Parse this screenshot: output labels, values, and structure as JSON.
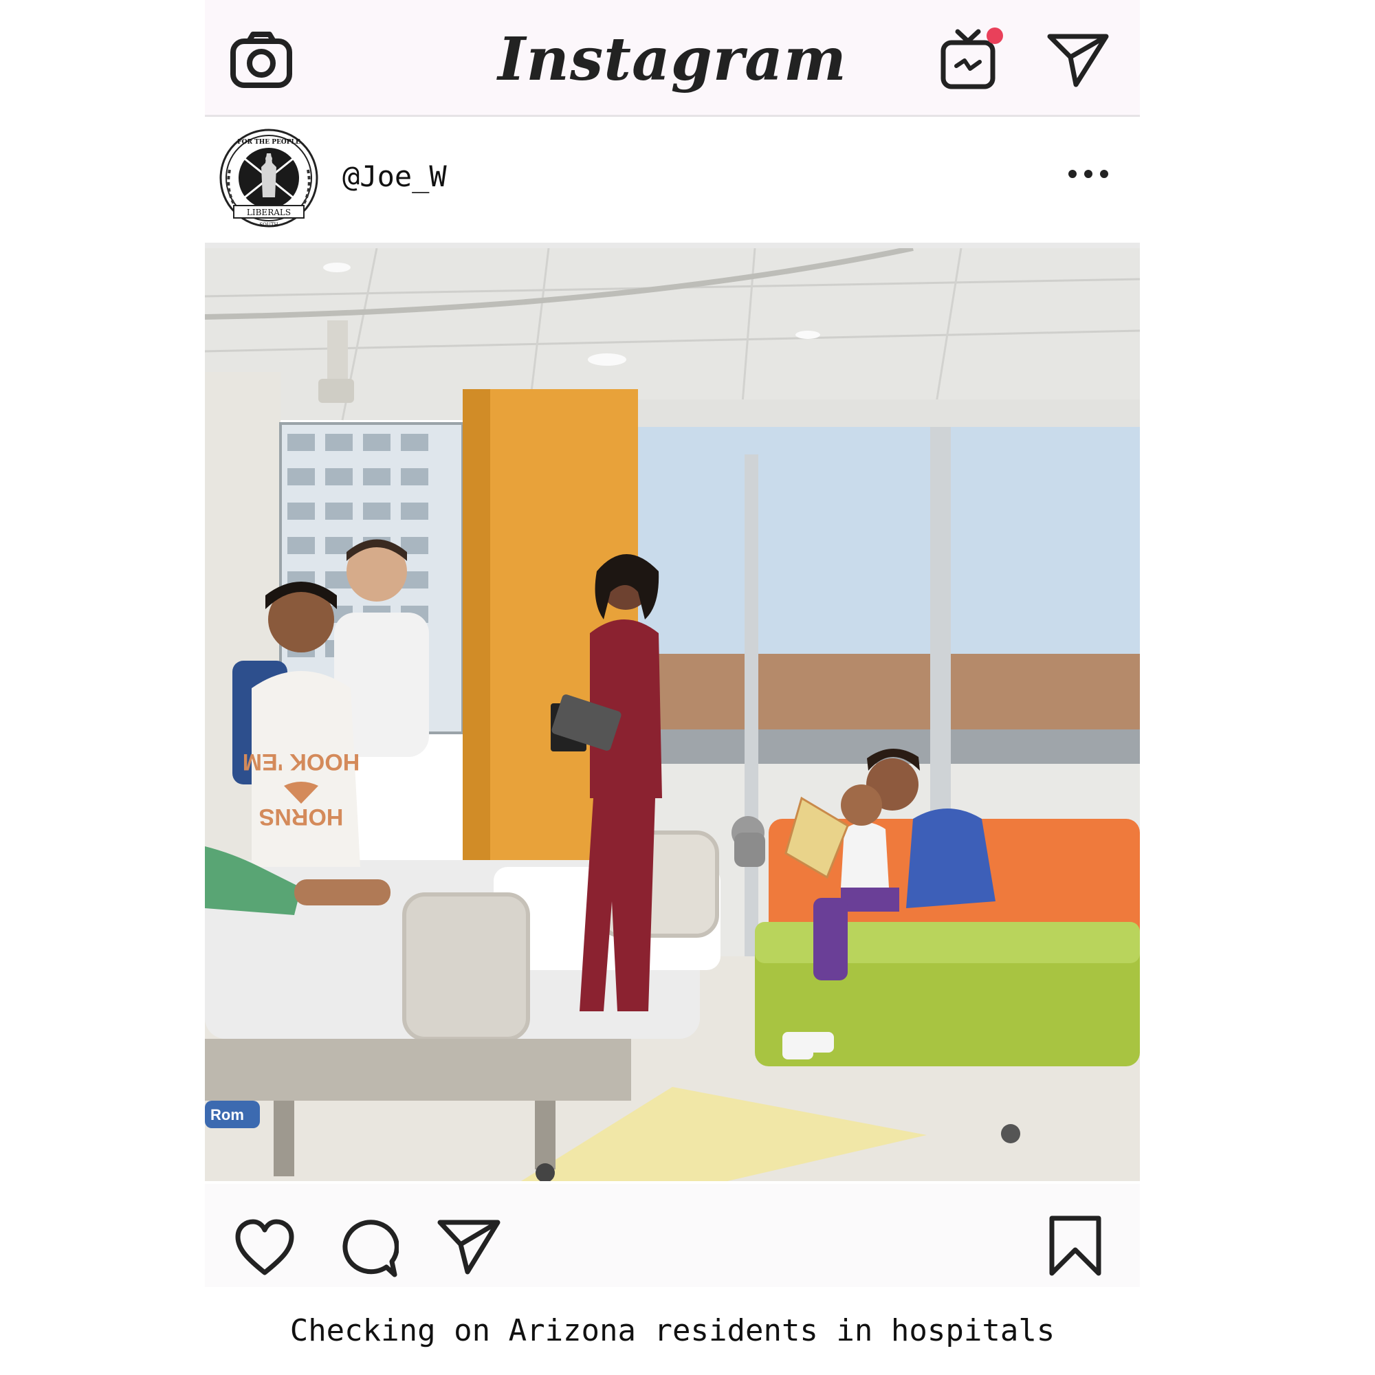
{
  "app": {
    "name": "Instagram"
  },
  "header": {
    "camera_icon": "camera-icon",
    "igtv_icon": "igtv-icon",
    "direct_icon": "paper-plane-icon",
    "notification_color": "#e9405a"
  },
  "post": {
    "avatar_seal": {
      "top_text": "FOR THE PEOPLE",
      "banner_text": "LIBERALS",
      "bottom_text": "SOUTH"
    },
    "username": "@Joe_W",
    "photo": {
      "shirt_line1": "HOOK 'EM",
      "shirt_line2": "HORNS",
      "bed_brand": "Rom"
    },
    "caption": "Checking on Arizona residents in hospitals"
  },
  "actions": {
    "like_icon": "heart-icon",
    "comment_icon": "comment-icon",
    "share_icon": "paper-plane-icon",
    "save_icon": "bookmark-icon"
  }
}
